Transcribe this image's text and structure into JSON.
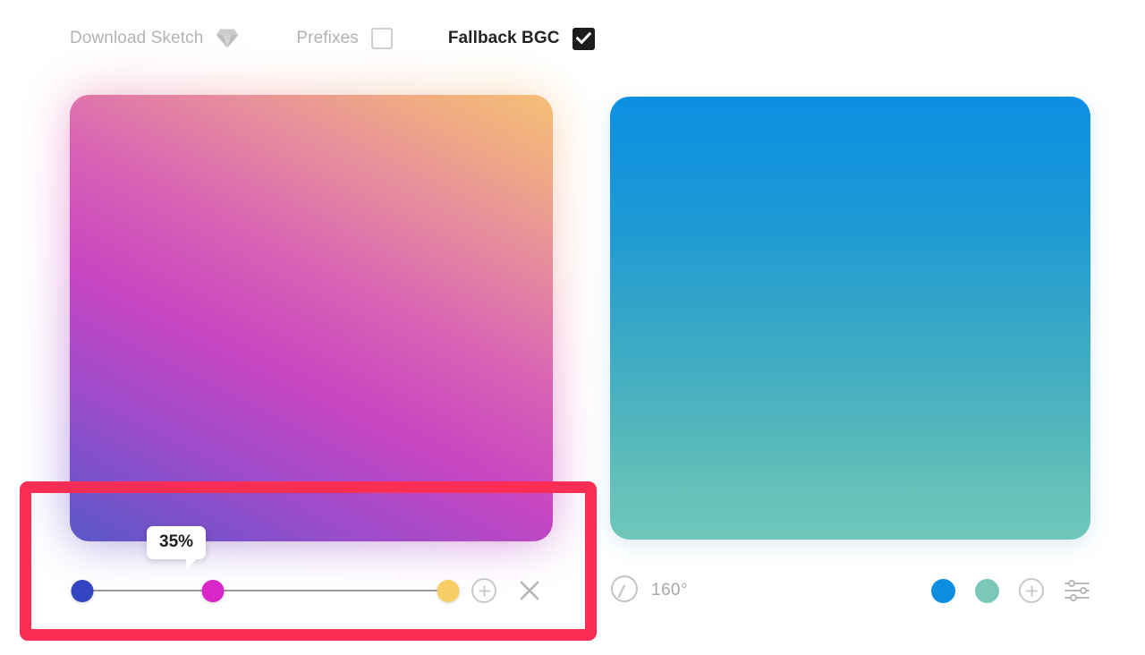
{
  "toolbar": {
    "download_sketch_label": "Download Sketch",
    "sketch_icon": "sketch-diamond-icon",
    "prefixes_label": "Prefixes",
    "prefixes_checked": false,
    "fallback_bgc_label": "Fallback BGC",
    "fallback_bgc_checked": true
  },
  "left_gradient_card": {
    "stops": [
      {
        "color": "#3344c0",
        "position": "0%"
      },
      {
        "color": "#d926c9",
        "position": "35%"
      },
      {
        "color": "#f9cd65",
        "position": "100%"
      }
    ],
    "active_stop_tooltip": "35%",
    "add_stop_label": "+",
    "remove_label": "×",
    "preview_colors": {
      "bottom_left": "#5a57c8",
      "middle": "#c845c1",
      "top_right": "#f5c077"
    }
  },
  "right_gradient_card": {
    "angle_label": "160°",
    "angle_icon": "angle-dial-icon",
    "swatches": [
      {
        "color": "#0d8ee0"
      },
      {
        "color": "#7cc8b8"
      }
    ],
    "add_stop_label": "+",
    "settings_icon": "sliders-settings-icon",
    "preview_colors": {
      "top": "#0d90e2",
      "bottom": "#70c7bb"
    }
  },
  "annotation": {
    "highlight_color": "#fa2d55"
  }
}
